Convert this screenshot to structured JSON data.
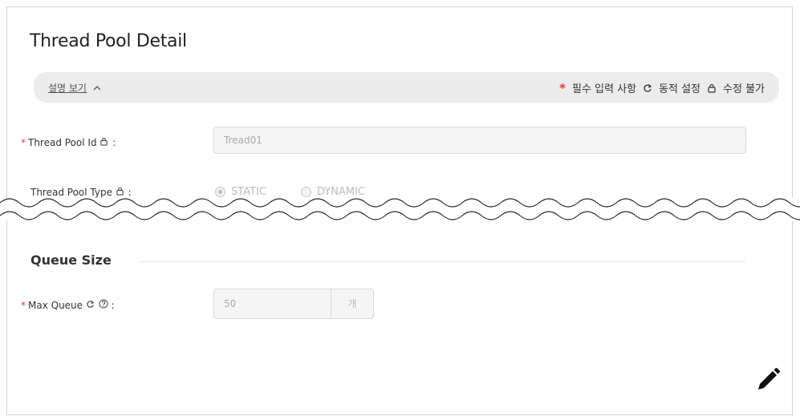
{
  "panel": {
    "title": "Thread Pool Detail"
  },
  "info_bar": {
    "desc_toggle": "설명 보기",
    "legend": {
      "required": "필수 입력 사항",
      "dynamic": "동적 설정",
      "readonly": "수정 불가"
    }
  },
  "fields": {
    "thread_pool_id": {
      "label": "Thread Pool Id",
      "suffix": ":",
      "value": "Tread01"
    },
    "thread_pool_type": {
      "label": "Thread Pool Type",
      "suffix": ":",
      "options": [
        "STATIC",
        "DYNAMIC"
      ],
      "selected": "STATIC"
    }
  },
  "queue_section": {
    "title": "Queue Size",
    "max_queue": {
      "label": "Max Queue",
      "suffix": ":",
      "value": "50",
      "unit": "개"
    }
  },
  "colors": {
    "required": "#e53935",
    "bar_bg": "#ececec",
    "input_bg": "#f5f5f5"
  },
  "icons": [
    "chevron-up-icon",
    "refresh-icon",
    "lock-icon",
    "help-icon",
    "edit-icon"
  ]
}
